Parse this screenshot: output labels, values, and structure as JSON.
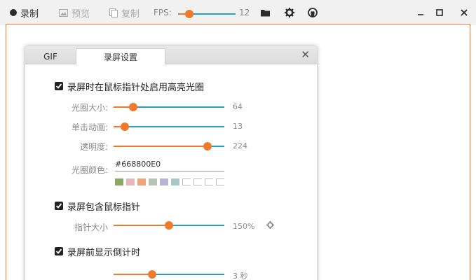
{
  "toolbar": {
    "record_label": "录制",
    "preview_label": "预览",
    "copy_label": "复制",
    "fps_label": "FPS:",
    "fps_value": "12",
    "fps_fraction": 0.2
  },
  "dialog": {
    "tabs": [
      {
        "label": "GIF"
      },
      {
        "label": "录屏设置"
      }
    ],
    "close_glyph": "✕",
    "highlight": {
      "checkbox_label": "录屏时在鼠标指针处启用高亮光圈",
      "checked": true,
      "size_label": "光圈大小:",
      "size_value": "64",
      "size_fraction": 0.18,
      "anim_label": "单击动画:",
      "anim_value": "13",
      "anim_fraction": 0.1,
      "opacity_label": "透明度:",
      "opacity_value": "224",
      "opacity_fraction": 0.85,
      "color_label": "光圈颜色:",
      "color_value": "#668800E0",
      "swatches": [
        "#8aa864",
        "#e5b7b9",
        "#f0a47a",
        "#b6c4b3",
        "#b9b4d1",
        "#a9c7c4"
      ],
      "empty_swatch_count": 4
    },
    "cursor": {
      "checkbox_label": "录屏包含鼠标指针",
      "checked": true,
      "size_label": "指针大小",
      "size_value": "150%",
      "size_fraction": 0.5
    },
    "countdown": {
      "checkbox_label": "录屏前显示倒计时",
      "checked": true,
      "value": "3 秒",
      "fraction": 0.35
    }
  },
  "colors": {
    "accent_orange": "#f07a2b",
    "slider_track_blue": "#2b9ec9"
  }
}
